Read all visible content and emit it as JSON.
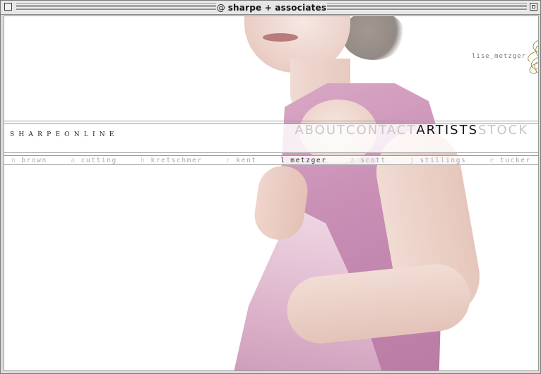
{
  "window": {
    "title": "sharpe + associates",
    "title_icon": "@"
  },
  "site": {
    "brand": "SHARPEONLINE",
    "nav": [
      {
        "label": "ABOUT",
        "active": false
      },
      {
        "label": "CONTACT",
        "active": false
      },
      {
        "label": "ARTISTS",
        "active": true
      },
      {
        "label": "STOCK",
        "active": false
      }
    ],
    "artists": [
      {
        "initial": "n",
        "name": "brown"
      },
      {
        "initial": "a",
        "name": "cutting"
      },
      {
        "initial": "h",
        "name": "kretschmer"
      },
      {
        "initial": "r",
        "name": "kent"
      },
      {
        "initial": "l",
        "name": "metzger",
        "active": true
      },
      {
        "initial": "z",
        "name": "scott"
      },
      {
        "initial": "j",
        "name": "stillings"
      },
      {
        "initial": "e",
        "name": "tucker"
      }
    ],
    "current_artist": "lise_metzger"
  },
  "colors": {
    "nav_inactive": "#c7c7c7",
    "nav_active": "#141414",
    "ornament": "#9a8a3a"
  },
  "icons": {
    "close": "close-box-icon",
    "zoom": "zoom-box-icon",
    "ornament": "flourish-icon"
  }
}
